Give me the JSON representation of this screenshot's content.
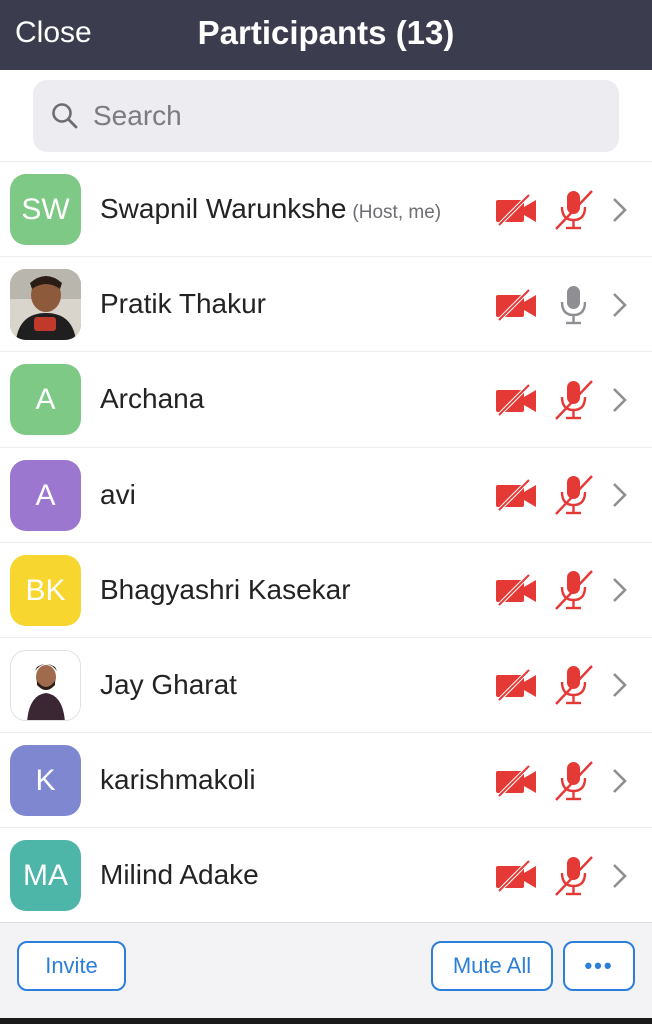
{
  "header": {
    "close_label": "Close",
    "title": "Participants (13)"
  },
  "search": {
    "placeholder": "Search"
  },
  "participants": [
    {
      "initials": "SW",
      "name": "Swapnil Warunkshe",
      "role": "(Host, me)",
      "avatar_color": "#7dc985",
      "avatar_type": "initials",
      "video": "off",
      "audio": "muted"
    },
    {
      "initials": "",
      "name": "Pratik Thakur",
      "role": "",
      "avatar_color": "#8a5a3c",
      "avatar_type": "photo",
      "video": "off",
      "audio": "unmuted"
    },
    {
      "initials": "A",
      "name": "Archana",
      "role": "",
      "avatar_color": "#7dc985",
      "avatar_type": "initials",
      "video": "off",
      "audio": "muted"
    },
    {
      "initials": "A",
      "name": "avi",
      "role": "",
      "avatar_color": "#9b77cf",
      "avatar_type": "initials",
      "video": "off",
      "audio": "muted"
    },
    {
      "initials": "BK",
      "name": "Bhagyashri Kasekar",
      "role": "",
      "avatar_color": "#f7d630",
      "avatar_type": "initials",
      "video": "off",
      "audio": "muted"
    },
    {
      "initials": "",
      "name": "Jay Gharat",
      "role": "",
      "avatar_color": "#ffffff",
      "avatar_type": "photo",
      "video": "off",
      "audio": "muted"
    },
    {
      "initials": "K",
      "name": "karishmakoli",
      "role": "",
      "avatar_color": "#7f87d1",
      "avatar_type": "initials",
      "video": "off",
      "audio": "muted"
    },
    {
      "initials": "MA",
      "name": "Milind Adake",
      "role": "",
      "avatar_color": "#4db6a9",
      "avatar_type": "initials",
      "video": "off",
      "audio": "muted"
    }
  ],
  "footer": {
    "invite_label": "Invite",
    "mute_all_label": "Mute All",
    "more_label": "•••"
  },
  "colors": {
    "header_bg": "#3b3d4f",
    "accent": "#2b7fd9",
    "muted_red": "#e53935",
    "mic_gray": "#8e8e93"
  },
  "icons": {
    "search": "search-icon",
    "video_off": "video-off-icon",
    "mic_muted": "mic-muted-icon",
    "mic": "mic-icon",
    "chevron": "chevron-right-icon"
  }
}
